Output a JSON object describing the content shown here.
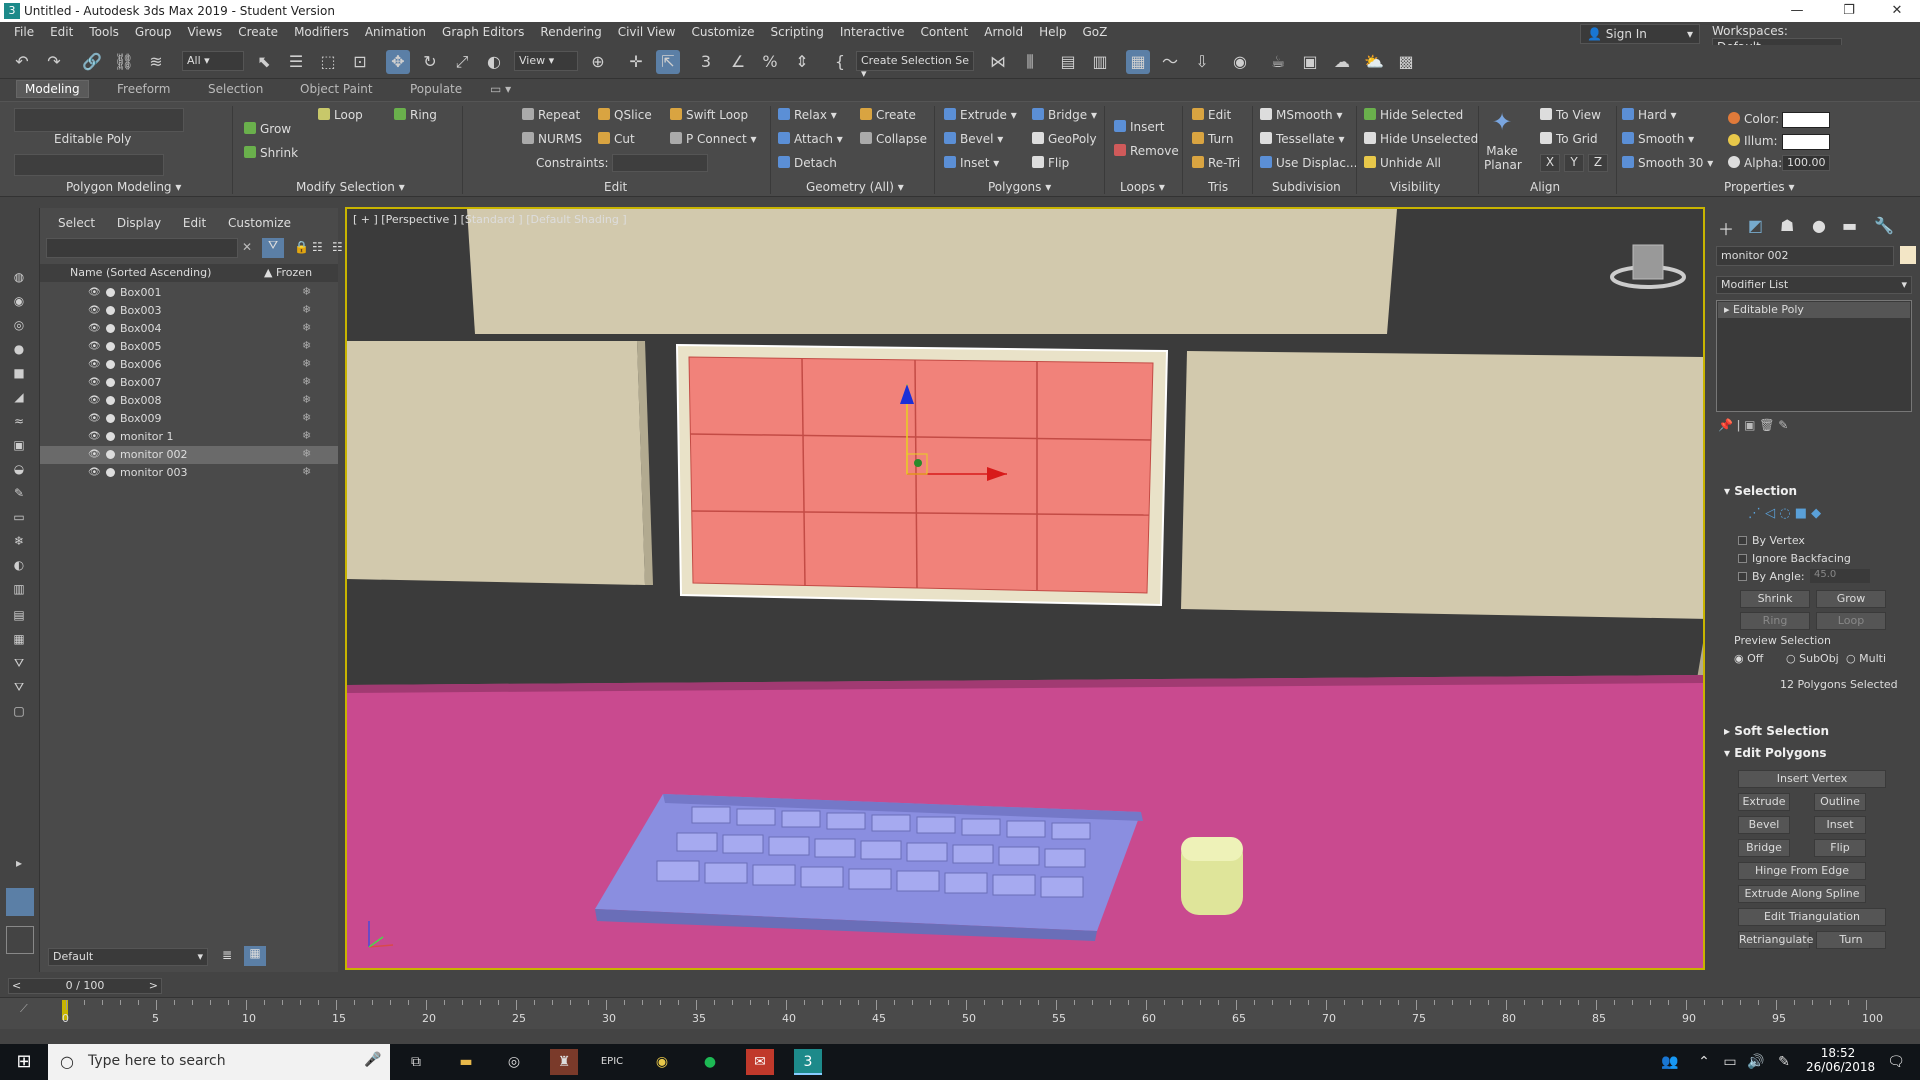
{
  "window": {
    "title": "Untitled - Autodesk 3ds Max 2019 - Student Version"
  },
  "menu": [
    "File",
    "Edit",
    "Tools",
    "Group",
    "Views",
    "Create",
    "Modifiers",
    "Animation",
    "Graph Editors",
    "Rendering",
    "Civil View",
    "Customize",
    "Scripting",
    "Interactive",
    "Content",
    "Arnold",
    "Help",
    "GoZ"
  ],
  "account": {
    "signin": "Sign In",
    "workspaces_label": "Workspaces:",
    "workspace": "Default"
  },
  "toolbar": {
    "filter": "All",
    "ref_coord": "View",
    "selection_set": "Create Selection Se"
  },
  "ribbon_tabs": [
    "Modeling",
    "Freeform",
    "Selection",
    "Object Paint",
    "Populate"
  ],
  "ribbon": {
    "polygon_modeling": {
      "label": "Editable Poly",
      "group": "Polygon Modeling"
    },
    "modify_selection": {
      "grow": "Grow",
      "shrink": "Shrink",
      "loop": "Loop",
      "ring": "Ring",
      "group": "Modify Selection"
    },
    "edit": {
      "repeat": "Repeat",
      "qslice": "QSlice",
      "swift_loop": "Swift Loop",
      "nurms": "NURMS",
      "cut": "Cut",
      "p_connect": "P Connect",
      "constraints": "Constraints:",
      "group": "Edit"
    },
    "geometry": {
      "relax": "Relax",
      "create": "Create",
      "attach": "Attach",
      "collapse": "Collapse",
      "detach": "Detach",
      "group": "Geometry (All)"
    },
    "polygons": {
      "extrude": "Extrude",
      "bridge": "Bridge",
      "bevel": "Bevel",
      "geopoly": "GeoPoly",
      "inset": "Inset",
      "flip": "Flip",
      "group": "Polygons"
    },
    "loops": {
      "insert": "Insert",
      "remove": "Remove",
      "group": "Loops"
    },
    "tris": {
      "edit": "Edit",
      "turn": "Turn",
      "retri": "Re-Tri",
      "group": "Tris"
    },
    "subdivision": {
      "msmooth": "MSmooth",
      "tessellate": "Tessellate",
      "use_displac": "Use Displac...",
      "group": "Subdivision"
    },
    "visibility": {
      "hide_selected": "Hide Selected",
      "hide_unselected": "Hide Unselected",
      "unhide_all": "Unhide All",
      "group": "Visibility"
    },
    "align": {
      "make_planar": "Make Planar",
      "to_view": "To View",
      "to_grid": "To Grid",
      "x": "X",
      "y": "Y",
      "z": "Z",
      "group": "Align"
    },
    "properties": {
      "hard": "Hard",
      "smooth": "Smooth",
      "smooth30": "Smooth 30",
      "color": "Color:",
      "illum": "Illum:",
      "alpha": "Alpha:",
      "alpha_value": "100.00",
      "group": "Properties"
    }
  },
  "explorer": {
    "tabs": [
      "Select",
      "Display",
      "Edit",
      "Customize"
    ],
    "col_name": "Name (Sorted Ascending)",
    "col_frozen": "Frozen",
    "objects": [
      "Box001",
      "Box003",
      "Box004",
      "Box005",
      "Box006",
      "Box007",
      "Box008",
      "Box009",
      "monitor 1",
      "monitor 002",
      "monitor 003"
    ],
    "selected": "monitor 002",
    "layer": "Default"
  },
  "viewport": {
    "label": "[ + ] [Perspective ] [Standard ] [Default Shading ]"
  },
  "command_panel": {
    "object_name": "monitor 002",
    "modifier_list": "Modifier List",
    "stack_item": "Editable Poly",
    "selection": {
      "title": "Selection",
      "by_vertex": "By Vertex",
      "ignore_backfacing": "Ignore Backfacing",
      "by_angle": "By Angle:",
      "angle_value": "45.0",
      "shrink": "Shrink",
      "grow": "Grow",
      "ring": "Ring",
      "loop": "Loop",
      "preview": "Preview Selection",
      "off": "Off",
      "subobj": "SubObj",
      "multi": "Multi",
      "status": "12 Polygons Selected"
    },
    "soft_selection": "Soft Selection",
    "edit_polygons": {
      "title": "Edit Polygons",
      "insert_vertex": "Insert Vertex",
      "extrude": "Extrude",
      "outline": "Outline",
      "bevel": "Bevel",
      "inset": "Inset",
      "bridge": "Bridge",
      "flip": "Flip",
      "hinge": "Hinge From Edge",
      "extrude_spline": "Extrude Along Spline",
      "edit_tri": "Edit Triangulation",
      "retriangulate": "Retriangulate",
      "turn": "Turn"
    }
  },
  "timeline": {
    "frame": "0 / 100",
    "ticks": [
      "0",
      "5",
      "10",
      "15",
      "20",
      "25",
      "30",
      "35",
      "40",
      "45",
      "50",
      "55",
      "60",
      "65",
      "70",
      "75",
      "80",
      "85",
      "90",
      "95",
      "100"
    ]
  },
  "taskbar": {
    "search": "Type here to search",
    "time": "18:52",
    "date": "26/06/2018"
  }
}
